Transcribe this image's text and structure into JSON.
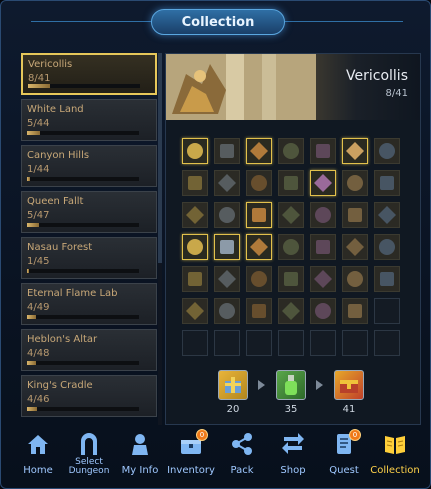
{
  "window": {
    "title": "Collection"
  },
  "zones": [
    {
      "name": "Vericollis",
      "progress": "8/41",
      "fraction": 0.195,
      "active": true
    },
    {
      "name": "White Land",
      "progress": "5/44",
      "fraction": 0.114,
      "active": false
    },
    {
      "name": "Canyon Hills",
      "progress": "1/44",
      "fraction": 0.023,
      "active": false
    },
    {
      "name": "Queen Fallt",
      "progress": "5/47",
      "fraction": 0.106,
      "active": false
    },
    {
      "name": "Nasau Forest",
      "progress": "1/45",
      "fraction": 0.022,
      "active": false
    },
    {
      "name": "Eternal Flame Lab",
      "progress": "4/49",
      "fraction": 0.082,
      "active": false
    },
    {
      "name": "Heblon's Altar",
      "progress": "4/48",
      "fraction": 0.083,
      "active": false
    },
    {
      "name": "King's Cradle",
      "progress": "4/46",
      "fraction": 0.087,
      "active": false
    }
  ],
  "selected_zone": {
    "name": "Vericollis",
    "progress": "8/41"
  },
  "collection_grid": {
    "columns": 7,
    "rows": 7,
    "cells": [
      "owned",
      "seen",
      "owned",
      "seen",
      "seen",
      "owned",
      "seen",
      "seen",
      "seen",
      "seen",
      "seen",
      "owned",
      "seen",
      "seen",
      "seen",
      "seen",
      "owned",
      "seen",
      "seen",
      "seen",
      "seen",
      "owned",
      "owned",
      "owned",
      "seen",
      "seen",
      "seen",
      "seen",
      "seen",
      "seen",
      "seen",
      "seen",
      "seen",
      "seen",
      "seen",
      "seen",
      "seen",
      "seen",
      "seen",
      "seen",
      "seen",
      "empty",
      "empty",
      "empty",
      "empty",
      "empty",
      "empty",
      "empty",
      "empty"
    ]
  },
  "rewards": [
    {
      "icon": "gift-box-icon",
      "label": "20"
    },
    {
      "icon": "potion-bottle-icon",
      "label": "35"
    },
    {
      "icon": "treasure-chest-icon",
      "label": "41"
    }
  ],
  "nav": [
    {
      "name": "home",
      "label": "Home",
      "icon": "home-icon",
      "badge": ""
    },
    {
      "name": "select-dungeon",
      "label": "Select Dungeon",
      "icon": "dungeon-gate-icon",
      "badge": ""
    },
    {
      "name": "my-info",
      "label": "My Info",
      "icon": "character-icon",
      "badge": ""
    },
    {
      "name": "inventory",
      "label": "Inventory",
      "icon": "inventory-chest-icon",
      "badge": "0"
    },
    {
      "name": "pack",
      "label": "Pack",
      "icon": "share-icon",
      "badge": ""
    },
    {
      "name": "shop",
      "label": "Shop",
      "icon": "exchange-arrows-icon",
      "badge": ""
    },
    {
      "name": "quest",
      "label": "Quest",
      "icon": "scroll-icon",
      "badge": "0"
    },
    {
      "name": "collection",
      "label": "Collection",
      "icon": "open-book-icon",
      "badge": "",
      "active": true
    }
  ],
  "colors": {
    "accent": "#ffd24a",
    "nav_text": "#9fc8ff",
    "frame": "#2a4a72"
  }
}
